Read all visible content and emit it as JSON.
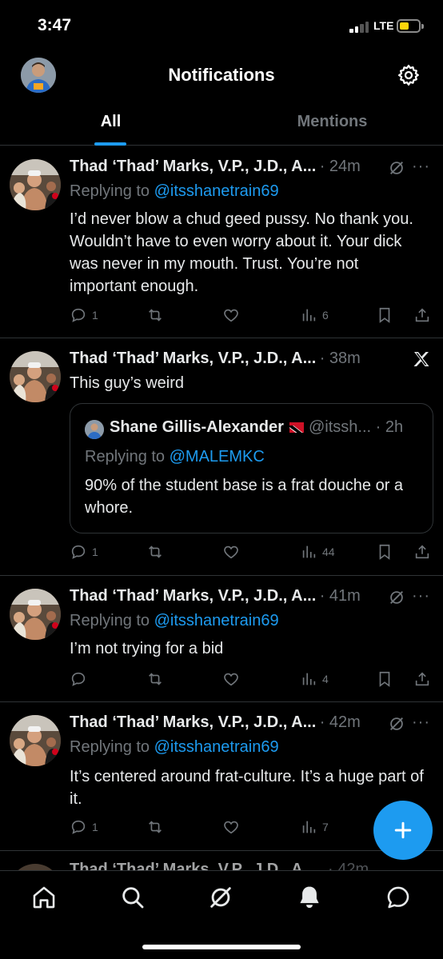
{
  "status_bar": {
    "time": "3:47",
    "network": "LTE",
    "battery_color": "#ffd60a"
  },
  "header": {
    "title": "Notifications",
    "avatar_icon": "profile-avatar",
    "settings_icon": "gear-icon"
  },
  "tabs": [
    {
      "label": "All",
      "active": true
    },
    {
      "label": "Mentions",
      "active": false
    }
  ],
  "colors": {
    "accent": "#1d9bf0",
    "muted": "#71767b",
    "text": "#e7e9ea",
    "border": "#2f3336"
  },
  "tweets": [
    {
      "name": "Thad ‘Thad’ Marks, V.P., J.D., A...",
      "time": "· 24m",
      "reply_prefix": "Replying to ",
      "reply_handle": "@itsshanetrain69",
      "text": "I’d never blow a chud geed pussy. No thank you. Wouldn’t have to even worry about it. Your dick was never in my mouth. Trust. You’re not important enough.",
      "replies": "1",
      "retweets": "",
      "likes": "",
      "views": "6"
    },
    {
      "name": "Thad ‘Thad’ Marks, V.P., J.D., A...",
      "time": "· 38m",
      "text": "This guy’s weird",
      "quote": {
        "name": "Shane Gillis-Alexander",
        "handle": "@itssh...",
        "time": "· 2h",
        "reply_prefix": "Replying to ",
        "reply_handle": "@MALEMKC",
        "text": "90% of the student base is a frat douche or a whore."
      },
      "replies": "1",
      "retweets": "",
      "likes": "",
      "views": "44"
    },
    {
      "name": "Thad ‘Thad’ Marks, V.P., J.D., A...",
      "time": "· 41m",
      "reply_prefix": "Replying to ",
      "reply_handle": "@itsshanetrain69",
      "text": "I’m not trying for a bid",
      "replies": "",
      "retweets": "",
      "likes": "",
      "views": "4"
    },
    {
      "name": "Thad ‘Thad’ Marks, V.P., J.D., A...",
      "time": "· 42m",
      "reply_prefix": "Replying to ",
      "reply_handle": "@itsshanetrain69",
      "text": "It’s centered around frat-culture. It’s a huge part of it.",
      "replies": "1",
      "retweets": "",
      "likes": "",
      "views": "7"
    }
  ],
  "partial_tweet": {
    "name": "Thad ‘Thad’ Marks, V.P., J.D., A...",
    "time": "· 42m"
  },
  "bottom_nav": [
    "home-icon",
    "search-icon",
    "communities-icon",
    "bell-icon",
    "messages-icon"
  ],
  "fab_icon": "plus-icon"
}
